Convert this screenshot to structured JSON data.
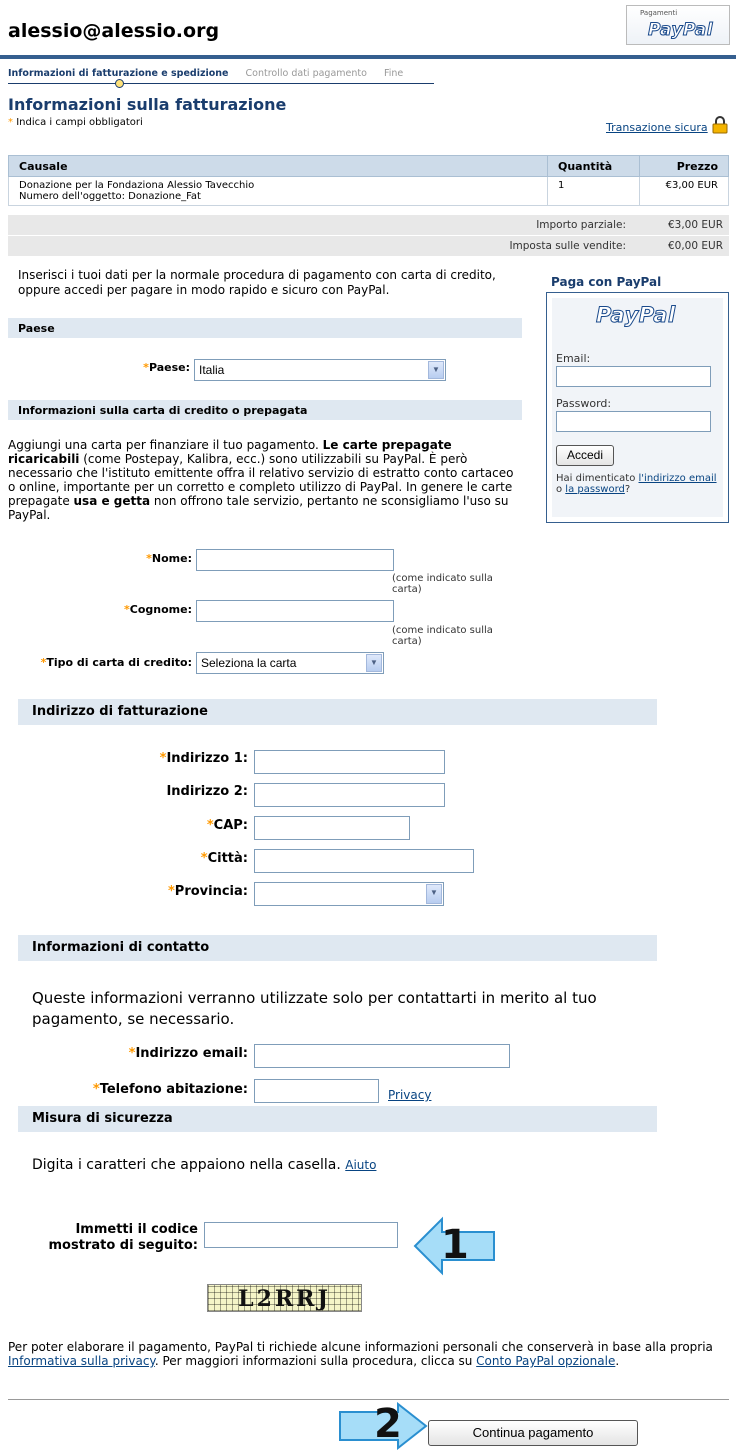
{
  "header": {
    "title": "alessio@alessio.org",
    "badge_small": "Pagamenti",
    "badge_logo": "PayPal"
  },
  "steps": [
    "Informazioni di fatturazione e spedizione",
    "Controllo dati pagamento",
    "Fine"
  ],
  "page": {
    "heading": "Informazioni sulla fatturazione",
    "required_note": "Indica i campi obbligatori",
    "secure_link": "Transazione sicura"
  },
  "order": {
    "headers": [
      "Causale",
      "Quantità",
      "Prezzo"
    ],
    "item_line1": "Donazione per la Fondaziona Alessio Tavecchio",
    "item_line2": "Numero dell'oggetto: Donazione_Fat",
    "quantity": "1",
    "price": "€3,00 EUR",
    "subtotal_label": "Importo parziale:",
    "subtotal_value": "€3,00 EUR",
    "tax_label": "Imposta sulle vendite:",
    "tax_value": "€0,00 EUR"
  },
  "intro": "Inserisci i tuoi dati per la normale procedura di pagamento con carta di credito, oppure accedi per pagare in modo rapido e sicuro con PayPal.",
  "country": {
    "section": "Paese",
    "label": "Paese:",
    "value": "Italia"
  },
  "card": {
    "section": "Informazioni sulla carta di credito o prepagata",
    "text_1": "Aggiungi una carta per finanziare il tuo pagamento. ",
    "text_bold1": "Le carte prepagate ricaricabili",
    "text_2": " (come Postepay, Kalibra, ecc.) sono utilizzabili su PayPal. È però necessario che l'istituto emittente offra il relativo servizio di estratto conto cartaceo o online, importante per un corretto e completo utilizzo di PayPal. In genere le carte prepagate ",
    "text_bold2": "usa e getta",
    "text_3": " non offrono tale servizio, pertanto ne sconsigliamo l'uso su PayPal.",
    "name_label": "Nome:",
    "surname_label": "Cognome:",
    "as_on_card": "(come indicato sulla carta)",
    "type_label": "Tipo di carta di credito:",
    "type_value": "Seleziona la carta"
  },
  "sidebar": {
    "title": "Paga con PayPal",
    "logo": "PayPal",
    "email_label": "Email:",
    "password_label": "Password:",
    "login_button": "Accedi",
    "forgot_prefix": "Hai dimenticato ",
    "forgot_email": "l'indirizzo email",
    "forgot_or": " o ",
    "forgot_password": "la password",
    "forgot_suffix": "?"
  },
  "billing": {
    "section": "Indirizzo di fatturazione",
    "address1": "Indirizzo 1:",
    "address2": "Indirizzo 2:",
    "zip": "CAP:",
    "city": "Città:",
    "province": "Provincia:"
  },
  "contact": {
    "section": "Informazioni di contatto",
    "text": "Queste informazioni verranno utilizzate solo per contattarti in merito al tuo pagamento, se necessario.",
    "email_label": "Indirizzo email:",
    "phone_label": "Telefono abitazione:",
    "privacy_link": "Privacy"
  },
  "security": {
    "section": "Misura di sicurezza",
    "text": "Digita i caratteri che appaiono nella casella. ",
    "help_link": "Aiuto",
    "code_label_1": "Immetti il codice",
    "code_label_2": "mostrato di seguito:",
    "captcha": "L2RRJ",
    "arrow_1": "1",
    "arrow_2": "2"
  },
  "footer": {
    "text_1": "Per poter elaborare il pagamento, PayPal ti richiede alcune informazioni personali che conserverà in base alla propria ",
    "privacy_link": "Informativa sulla privacy",
    "text_2": ". Per maggiori informazioni sulla procedura, clicca su ",
    "optional_link": "Conto PayPal opzionale",
    "text_3": ".",
    "continue_button": "Continua pagamento"
  },
  "colors": {
    "brand_blue": "#355f8f",
    "heading_blue": "#1a3d6d",
    "section_bg": "#dfe8f1",
    "required": "#ff9900",
    "arrow_blue": "#8fd0f5"
  }
}
